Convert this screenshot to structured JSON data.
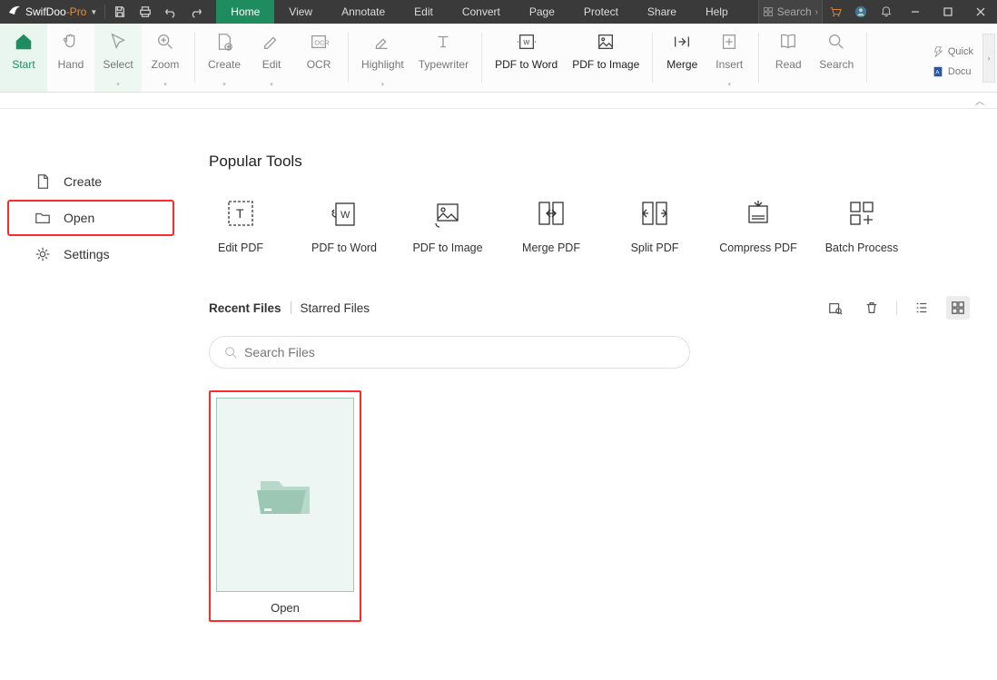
{
  "app": {
    "name_a": "SwifDoo",
    "name_b": "-Pro"
  },
  "menu": [
    "Home",
    "View",
    "Annotate",
    "Edit",
    "Convert",
    "Page",
    "Protect",
    "Share",
    "Help"
  ],
  "menu_active": 0,
  "titlebar_search_placeholder": "Search",
  "ribbon": {
    "start": "Start",
    "hand": "Hand",
    "select": "Select",
    "zoom": "Zoom",
    "create": "Create",
    "edit": "Edit",
    "ocr": "OCR",
    "highlight": "Highlight",
    "typewriter": "Typewriter",
    "pdf_to_word": "PDF to Word",
    "pdf_to_image": "PDF to Image",
    "merge": "Merge",
    "insert": "Insert",
    "read": "Read",
    "search": "Search",
    "quick": "Quick",
    "docu": "Docu"
  },
  "sidebar": {
    "create": "Create",
    "open": "Open",
    "settings": "Settings"
  },
  "content": {
    "popular_title": "Popular Tools",
    "tools": [
      "Edit PDF",
      "PDF to Word",
      "PDF to Image",
      "Merge PDF",
      "Split PDF",
      "Compress PDF",
      "Batch Process"
    ],
    "recent_label": "Recent Files",
    "starred_label": "Starred Files",
    "search_placeholder": "Search Files",
    "open_card_label": "Open"
  }
}
